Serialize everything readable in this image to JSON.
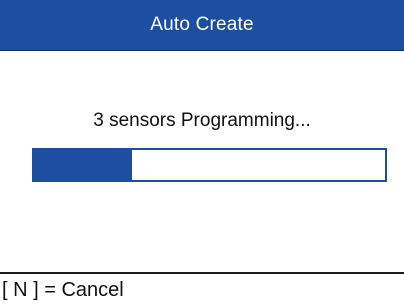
{
  "header": {
    "title": "Auto Create"
  },
  "main": {
    "status": "3 sensors Programming...",
    "progress": 0.28
  },
  "footer": {
    "cancel_hint": "[ N ] = Cancel"
  },
  "colors": {
    "accent": "#1d4fa1",
    "background": "#ffffff",
    "text": "#111111"
  }
}
